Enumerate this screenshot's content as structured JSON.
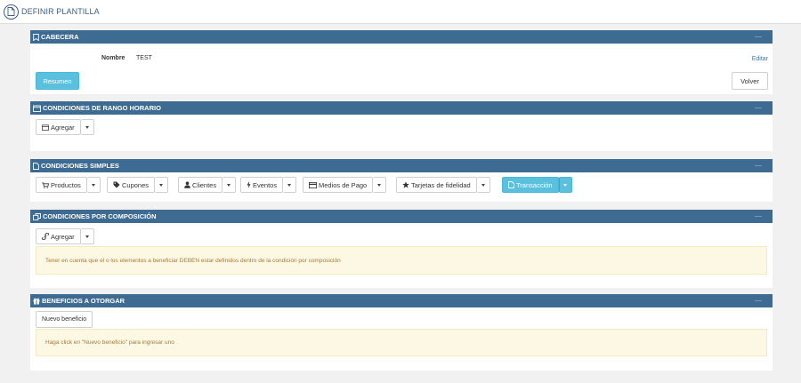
{
  "page": {
    "title": "DEFINIR PLANTILLA"
  },
  "cabecera": {
    "title": "CABECERA",
    "nombre_label": "Nombre",
    "nombre_value": "TEST",
    "editar": "Editar",
    "resumen": "Resumen",
    "volver": "Volver"
  },
  "rango": {
    "title": "CONDICIONES DE RANGO HORARIO",
    "agregar": "Agregar"
  },
  "simples": {
    "title": "CONDICIONES SIMPLES",
    "buttons": {
      "productos": "Productos",
      "cupones": "Cupones",
      "clientes": "Clientes",
      "eventos": "Eventos",
      "medios": "Medios de Pago",
      "tarjetas": "Tarjetas de fidelidad",
      "transaccion": "Transacción"
    }
  },
  "composicion": {
    "title": "CONDICIONES POR COMPOSICIÓN",
    "agregar": "Agregar",
    "note": "Tener en cuenta que el o los elementos a beneficiar DEBEN estar definidos dentro de la condición por composición"
  },
  "beneficios": {
    "title": "BENEFICIOS A OTORGAR",
    "nuevo": "Nuevo beneficio",
    "note": "Haga click en \"Nuevo beneficio\" para ingresar uno"
  },
  "colors": {
    "header": "#3e6b91",
    "primary": "#5bc0de",
    "warning_bg": "#fcf8e3",
    "warning_text": "#a87a3a"
  }
}
